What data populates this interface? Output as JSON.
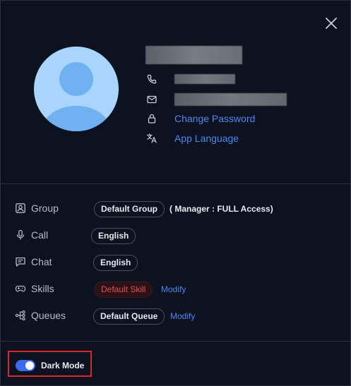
{
  "profile": {
    "change_password": "Change Password",
    "app_language": "App Language"
  },
  "details": {
    "group_label": "Group",
    "group_value": "Default Group",
    "access_prefix": "( Manager : ",
    "access_level": "FULL",
    "access_suffix": " Access)",
    "call_label": "Call",
    "call_value": "English",
    "chat_label": "Chat",
    "chat_value": "English",
    "skills_label": "Skills",
    "skills_value": "Default Skill",
    "skills_modify": "Modify",
    "queues_label": "Queues",
    "queues_value": "Default Queue",
    "queues_modify": "Modify"
  },
  "footer": {
    "dark_mode_label": "Dark Mode",
    "dark_mode_on": true
  },
  "colors": {
    "accent": "#4c86f0",
    "toggle": "#3b6cf0",
    "danger": "#e0524e",
    "highlight": "#d9262b"
  }
}
